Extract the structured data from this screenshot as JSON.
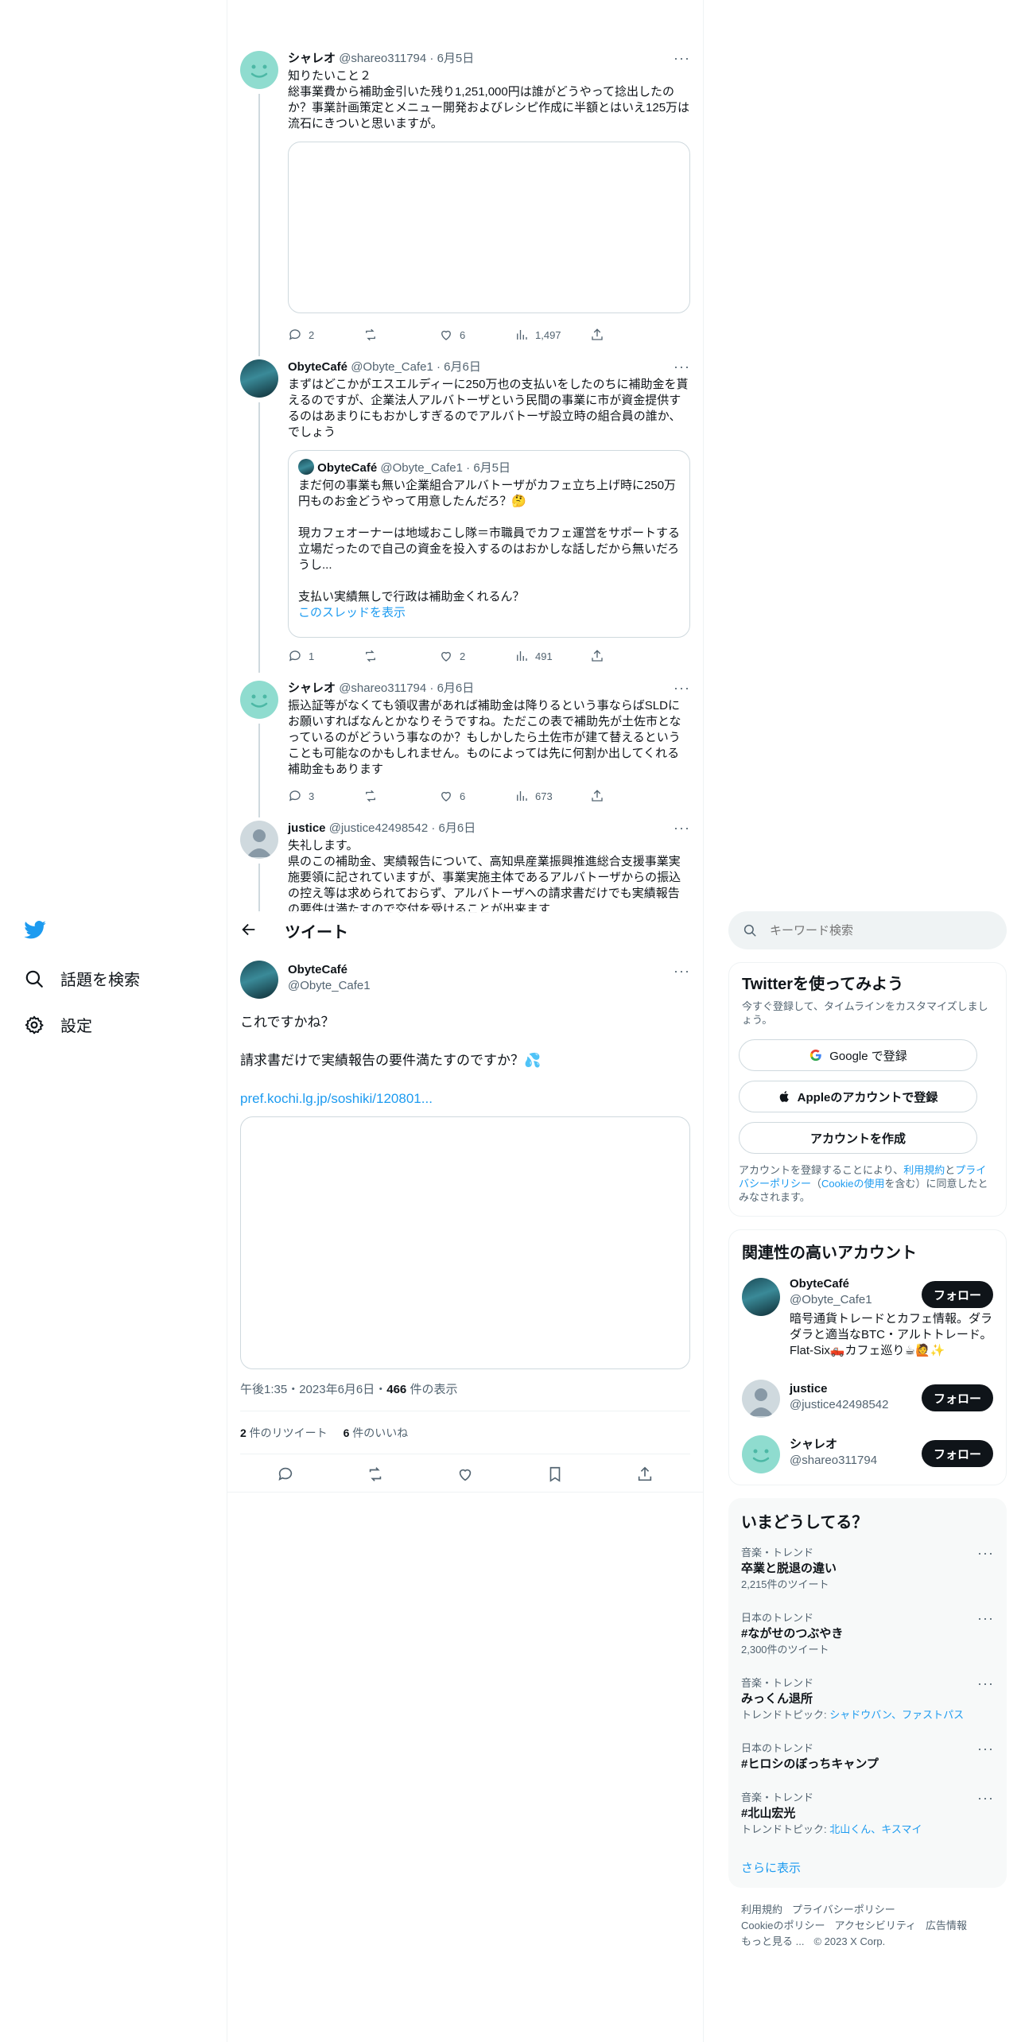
{
  "sidebar": {
    "items": [
      {
        "icon": "search-icon",
        "label": "話題を検索"
      },
      {
        "icon": "gear-icon",
        "label": "設定"
      }
    ]
  },
  "thread": {
    "tweets": [
      {
        "name": "シャレオ",
        "handle": "@shareo311794",
        "date": "6月5日",
        "text": "知りたいこと２\n総事業費から補助金引いた残り1,251,000円は誰がどうやって捻出したのか？事業計画策定とメニュー開発およびレシピ作成に半額とはいえ125万は流石にきついと思いますが。",
        "stats": {
          "replies": "2",
          "retweets": "",
          "likes": "6",
          "views": "1,497"
        }
      },
      {
        "name": "ObyteCafé",
        "handle": "@Obyte_Cafe1",
        "date": "6月6日",
        "text": "まずはどこかがエスエルディーに250万也の支払いをしたのちに補助金を貰えるのですが、企業法人アルバトーザという民間の事業に市が資金提供するのはあまりにもおかしすぎるのでアルバトーザ設立時の組合員の誰か、でしょう",
        "quote": {
          "name": "ObyteCafé",
          "handle": "@Obyte_Cafe1",
          "date": "6月5日",
          "text": "まだ何の事業も無い企業組合アルバトーザがカフェ立ち上げ時に250万円ものお金どうやって用意したんだろ？🤔\n\n現カフェオーナーは地域おこし隊＝市職員でカフェ運営をサポートする立場だったので自己の資金を投入するのはおかしな話しだから無いだろうし...\n\n支払い実績無しで行政は補助金くれるん？",
          "link": "このスレッドを表示"
        },
        "stats": {
          "replies": "1",
          "retweets": "",
          "likes": "2",
          "views": "491"
        }
      },
      {
        "name": "シャレオ",
        "handle": "@shareo311794",
        "date": "6月6日",
        "text": "振込証等がなくても領収書があれば補助金は降りるという事ならばSLDにお願いすればなんとかなりそうですね。ただこの表で補助先が土佐市となっているのがどういう事なのか？もしかしたら土佐市が建て替えるということも可能なのかもしれません。ものによっては先に何割か出してくれる補助金もあります",
        "stats": {
          "replies": "3",
          "retweets": "",
          "likes": "6",
          "views": "673"
        }
      },
      {
        "name": "justice",
        "handle": "@justice42498542",
        "date": "6月6日",
        "text": "失礼します。\n県のこの補助金、実績報告について、高知県産業振興推進総合支援事業実施要領に記されていますが、事業実施主体であるアルバトーザからの振込の控え等は求められておらず、アルバトーザへの請求書だけでも実績報告の要件は満たすので交付を受けることが出来ます"
      }
    ]
  },
  "header": {
    "title": "ツイート"
  },
  "main_tweet": {
    "name": "ObyteCafé",
    "handle": "@Obyte_Cafe1",
    "line1": "これですかね？",
    "line2": "請求書だけで実績報告の要件満たすのですか？💦",
    "link": "pref.kochi.lg.jp/soshiki/120801...",
    "time": "午後1:35・2023年6月6日・",
    "views_count": "466",
    "views_label": " 件の表示",
    "retweets_count": "2",
    "retweets_label": " 件のリツイート",
    "likes_count": "6",
    "likes_label": " 件のいいね"
  },
  "search": {
    "placeholder": "キーワード検索"
  },
  "signup": {
    "title": "Twitterを使ってみよう",
    "subtitle": "今すぐ登録して、タイムラインをカスタマイズしましょう。",
    "google": "Google で登録",
    "apple": "Appleのアカウントで登録",
    "create": "アカウントを作成",
    "legal_1": "アカウントを登録することにより、",
    "legal_terms": "利用規約",
    "legal_2": "と",
    "legal_privacy": "プライバシーポリシー",
    "legal_3": "（",
    "legal_cookie": "Cookieの使用",
    "legal_4": "を含む）に同意したとみなされます。"
  },
  "related": {
    "title": "関連性の高いアカウント",
    "follow": "フォロー",
    "accounts": [
      {
        "name": "ObyteCafé",
        "handle": "@Obyte_Cafe1",
        "bio": "暗号通貨トレードとカフェ情報。ダラダラと適当なBTC・アルトトレード。Flat-Six🛻カフェ巡り☕🙋✨"
      },
      {
        "name": "justice",
        "handle": "@justice42498542"
      },
      {
        "name": "シャレオ",
        "handle": "@shareo311794"
      }
    ]
  },
  "trends": {
    "title": "いまどうしてる？",
    "items": [
      {
        "meta": "音楽・トレンド",
        "name": "卒業と脱退の違い",
        "sub": "2,215件のツイート"
      },
      {
        "meta": "日本のトレンド",
        "name": "#ながせのつぶやき",
        "sub": "2,300件のツイート"
      },
      {
        "meta": "音楽・トレンド",
        "name": "みっくん退所",
        "sub_prefix": "トレンドトピック: ",
        "sub_links": "シャドウバン、ファストパス"
      },
      {
        "meta": "日本のトレンド",
        "name": "#ヒロシのぼっちキャンプ"
      },
      {
        "meta": "音楽・トレンド",
        "name": "#北山宏光",
        "sub_prefix": "トレンドトピック: ",
        "sub_links": "北山くん、キスマイ"
      }
    ],
    "show_more": "さらに表示"
  },
  "footer": {
    "terms": "利用規約",
    "privacy": "プライバシーポリシー",
    "cookie": "Cookieのポリシー",
    "accessibility": "アクセシビリティ",
    "ads": "広告情報",
    "more": "もっと見る ...",
    "copyright": "© 2023 X Corp."
  }
}
